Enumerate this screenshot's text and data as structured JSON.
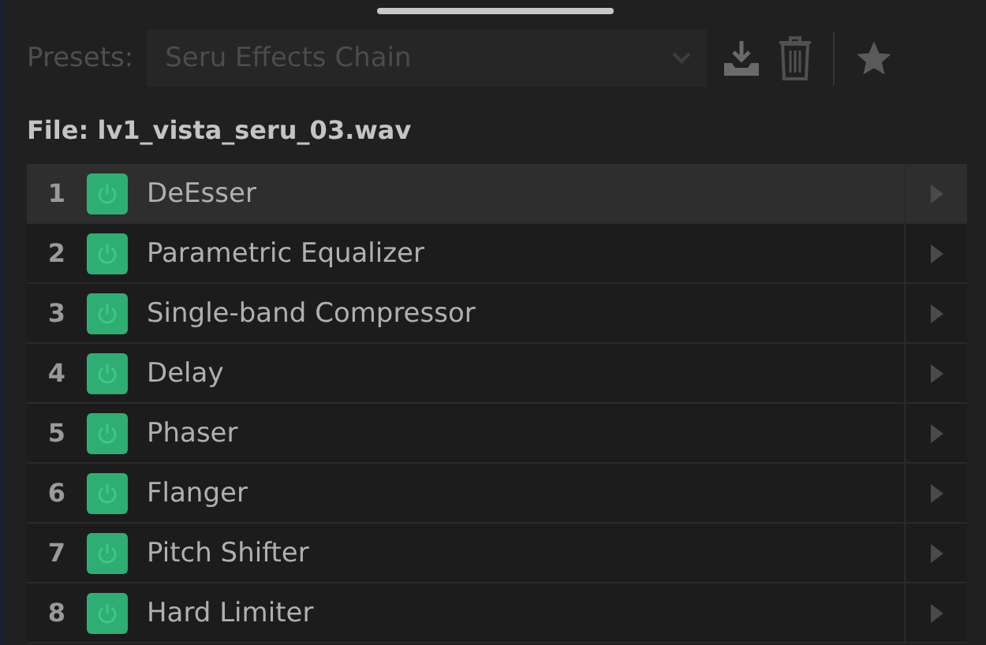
{
  "presets": {
    "label": "Presets:",
    "value": "Seru Effects Chain"
  },
  "file": "File: lv1_vista_seru_03.wav",
  "effects": [
    {
      "number": "1",
      "name": "DeEsser",
      "on": true,
      "selected": true
    },
    {
      "number": "2",
      "name": "Parametric Equalizer",
      "on": true,
      "selected": false
    },
    {
      "number": "3",
      "name": "Single-band Compressor",
      "on": true,
      "selected": false
    },
    {
      "number": "4",
      "name": "Delay",
      "on": true,
      "selected": false
    },
    {
      "number": "5",
      "name": "Phaser",
      "on": true,
      "selected": false
    },
    {
      "number": "6",
      "name": "Flanger",
      "on": true,
      "selected": false
    },
    {
      "number": "7",
      "name": "Pitch Shifter",
      "on": true,
      "selected": false
    },
    {
      "number": "8",
      "name": "Hard Limiter",
      "on": true,
      "selected": false
    }
  ]
}
